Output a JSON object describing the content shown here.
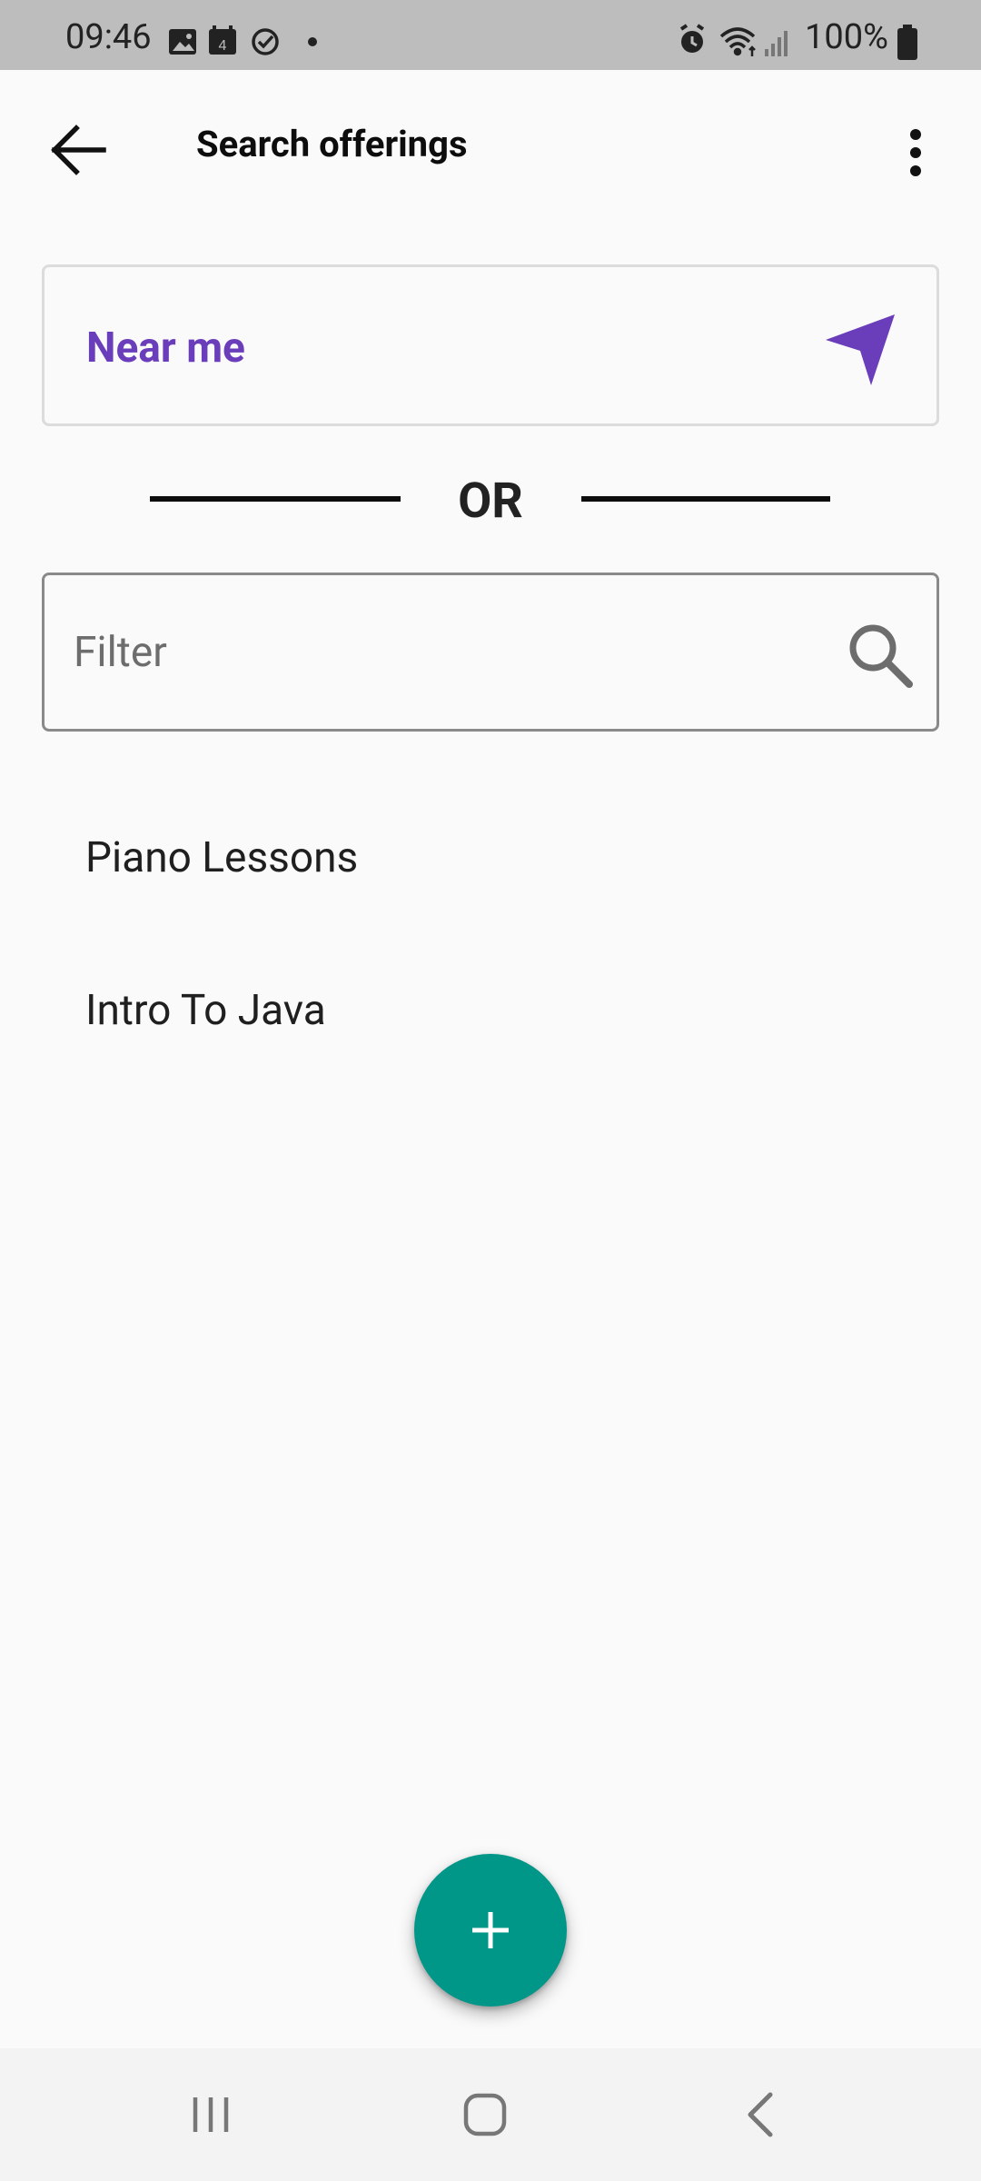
{
  "status_bar": {
    "time": "09:46",
    "battery": "100%",
    "left_icons": [
      "image-icon",
      "calendar-icon",
      "check-circle-icon",
      "dot-icon"
    ],
    "calendar_day": "4",
    "right_icons": [
      "alarm-icon",
      "wifi-icon",
      "signal-icon",
      "battery-icon"
    ]
  },
  "app_bar": {
    "title": "Search offerings",
    "back_icon": "arrow-back-icon",
    "menu_icon": "more-vert-icon"
  },
  "near_me": {
    "label": "Near me",
    "icon": "navigation-arrow-icon",
    "accent_color": "#6a3dba"
  },
  "divider": {
    "label": "OR"
  },
  "filter": {
    "placeholder": "Filter",
    "value": "",
    "icon": "search-icon"
  },
  "offerings": [
    {
      "label": "Piano Lessons"
    },
    {
      "label": "Intro To Java"
    }
  ],
  "fab": {
    "icon": "plus-icon",
    "color": "#009688"
  },
  "nav_bar": {
    "buttons": [
      "recents-icon",
      "home-icon",
      "nav-back-icon"
    ]
  }
}
